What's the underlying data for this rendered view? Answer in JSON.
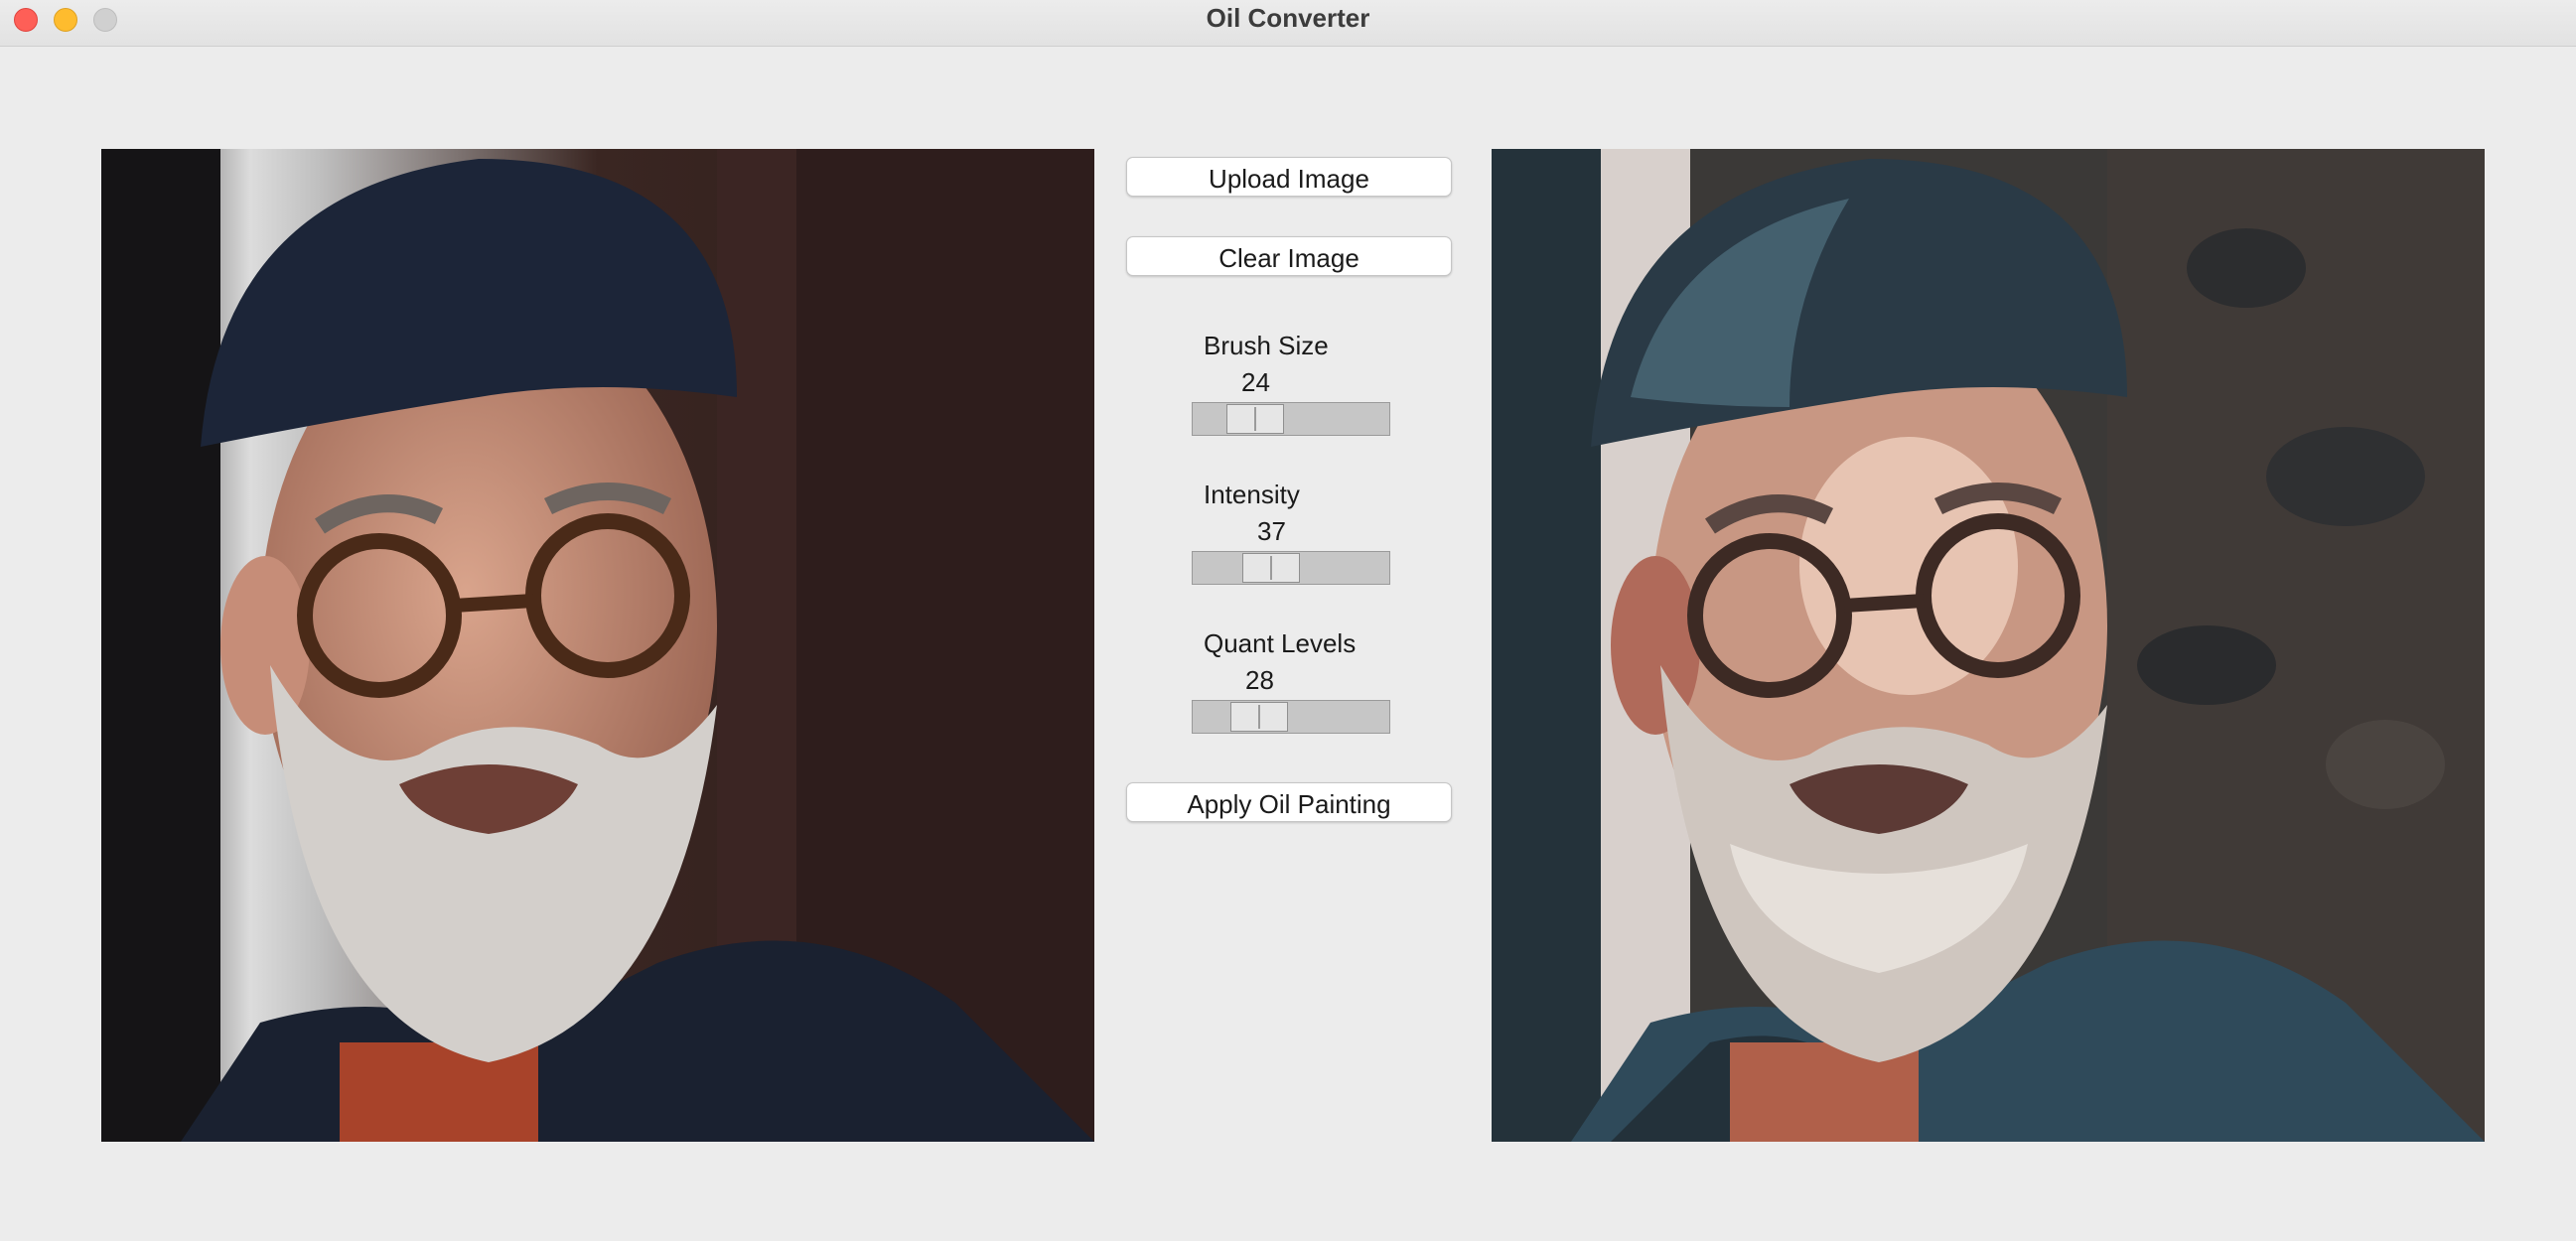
{
  "window": {
    "title": "Oil Converter"
  },
  "controls": {
    "upload_label": "Upload Image",
    "clear_label": "Clear Image",
    "apply_label": "Apply Oil Painting",
    "brush_size": {
      "label": "Brush Size",
      "value": "24"
    },
    "intensity": {
      "label": "Intensity",
      "value": "37"
    },
    "quant_levels": {
      "label": "Quant Levels",
      "value": "28"
    }
  },
  "images": {
    "original": "photo-portrait-man-beret-glasses",
    "processed": "oil-painting-portrait-man-beret-glasses"
  }
}
